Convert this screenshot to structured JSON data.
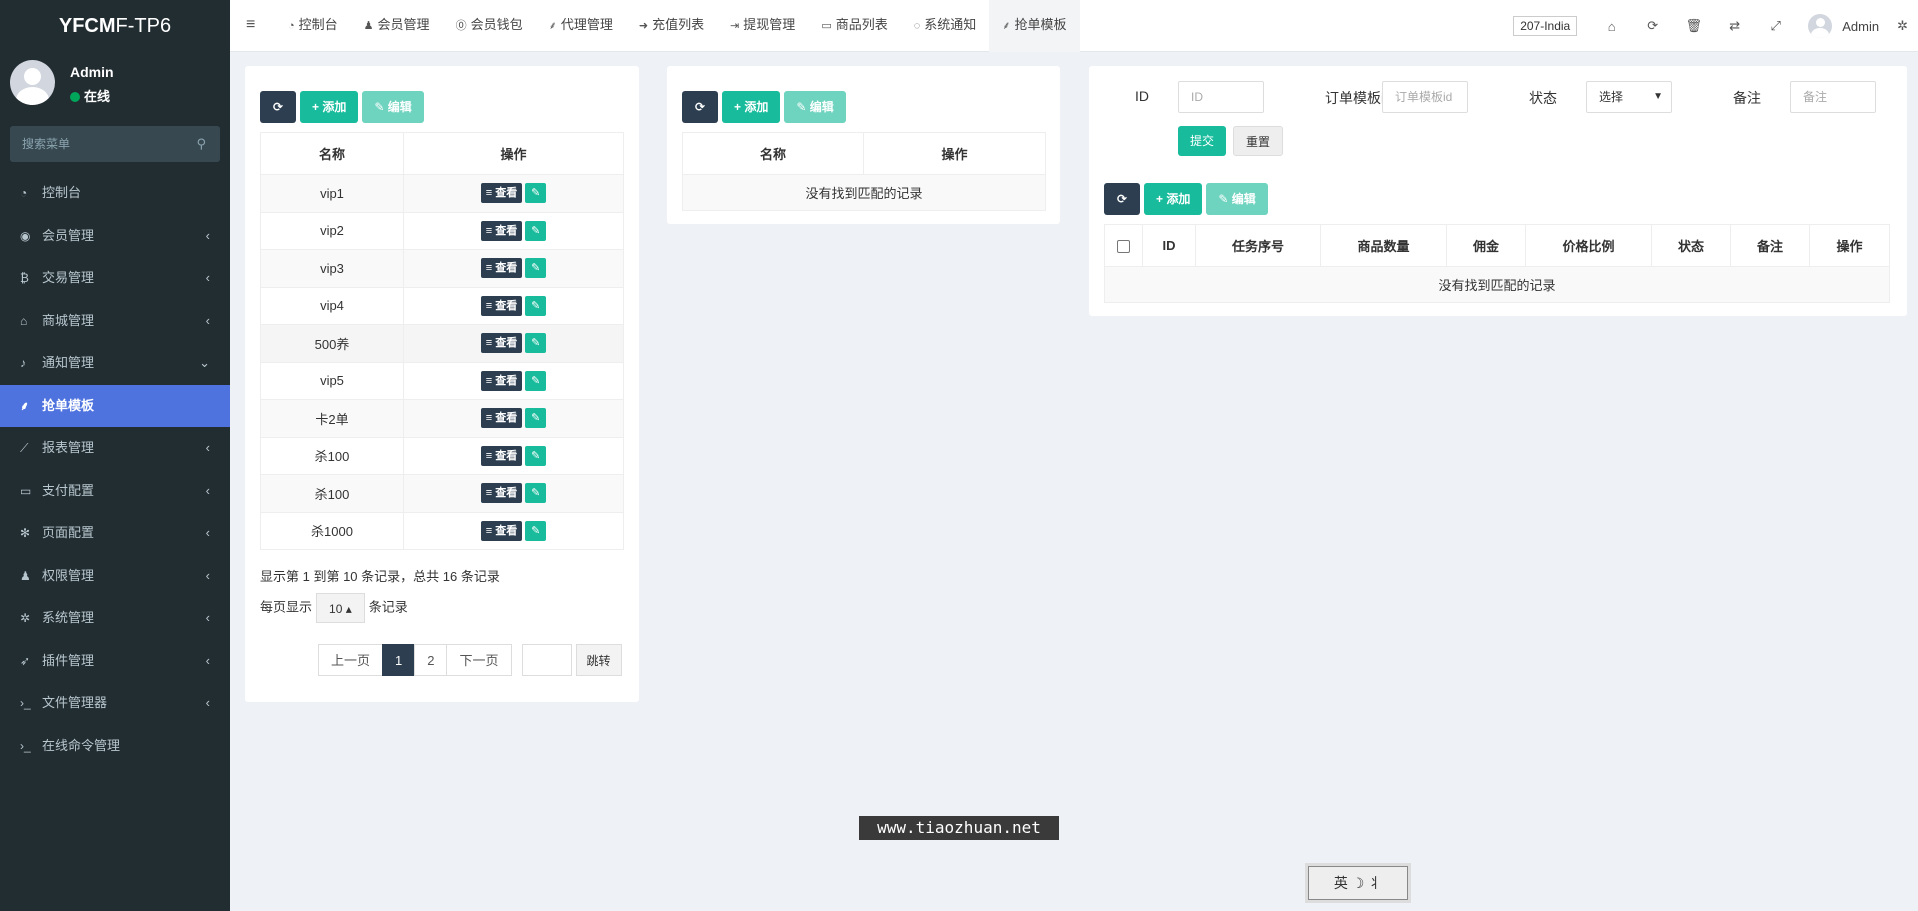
{
  "app": {
    "logo_bold": "YFCM",
    "logo_thin": "F-TP6"
  },
  "user": {
    "name": "Admin",
    "status": "在线"
  },
  "sidebar": {
    "search_placeholder": "搜索菜单",
    "items": [
      {
        "label": "控制台",
        "icon": "dashboard-icon",
        "glyph": "◔",
        "has_arrow": false,
        "active": false
      },
      {
        "label": "会员管理",
        "icon": "user-circle-icon",
        "glyph": "◉",
        "has_arrow": true,
        "arrow": "‹",
        "active": false
      },
      {
        "label": "交易管理",
        "icon": "bitcoin-icon",
        "glyph": "₿",
        "has_arrow": true,
        "arrow": "‹",
        "active": false
      },
      {
        "label": "商城管理",
        "icon": "home-icon",
        "glyph": "⌂",
        "has_arrow": true,
        "arrow": "‹",
        "active": false
      },
      {
        "label": "通知管理",
        "icon": "bell-icon",
        "glyph": "♪",
        "has_arrow": true,
        "arrow": "⌄",
        "active": false
      },
      {
        "label": "抢单模板",
        "icon": "sitemap-icon",
        "glyph": "⸙",
        "has_arrow": false,
        "active": true
      },
      {
        "label": "报表管理",
        "icon": "line-chart-icon",
        "glyph": "⟋",
        "has_arrow": true,
        "arrow": "‹",
        "active": false
      },
      {
        "label": "支付配置",
        "icon": "credit-card-icon",
        "glyph": "▭",
        "has_arrow": true,
        "arrow": "‹",
        "active": false
      },
      {
        "label": "页面配置",
        "icon": "cog-icon",
        "glyph": "✻",
        "has_arrow": true,
        "arrow": "‹",
        "active": false
      },
      {
        "label": "权限管理",
        "icon": "users-group-icon",
        "glyph": "♟",
        "has_arrow": true,
        "arrow": "‹",
        "active": false
      },
      {
        "label": "系统管理",
        "icon": "cogs-icon",
        "glyph": "✲",
        "has_arrow": true,
        "arrow": "‹",
        "active": false
      },
      {
        "label": "插件管理",
        "icon": "rocket-icon",
        "glyph": "➶",
        "has_arrow": true,
        "arrow": "‹",
        "active": false
      },
      {
        "label": "文件管理器",
        "icon": "terminal-icon",
        "glyph": "›_",
        "has_arrow": true,
        "arrow": "‹",
        "active": false
      },
      {
        "label": "在线命令管理",
        "icon": "terminal-icon",
        "glyph": "›_",
        "has_arrow": false,
        "active": false
      }
    ]
  },
  "topnav": {
    "tabs": [
      {
        "label": "控制台",
        "icon": "dashboard-icon",
        "glyph": "◔",
        "active": false
      },
      {
        "label": "会员管理",
        "icon": "user-icon",
        "glyph": "♟",
        "active": false
      },
      {
        "label": "会员钱包",
        "icon": "wallet-icon",
        "glyph": "⓪",
        "active": false
      },
      {
        "label": "代理管理",
        "icon": "sitemap-icon",
        "glyph": "⸙",
        "active": false
      },
      {
        "label": "充值列表",
        "icon": "sign-in-icon",
        "glyph": "➜",
        "active": false
      },
      {
        "label": "提现管理",
        "icon": "sign-out-icon",
        "glyph": "⇥",
        "active": false
      },
      {
        "label": "商品列表",
        "icon": "desktop-icon",
        "glyph": "▭",
        "active": false
      },
      {
        "label": "系统通知",
        "icon": "comments-icon",
        "glyph": "◌",
        "active": false
      },
      {
        "label": "抢单模板",
        "icon": "sitemap-icon",
        "glyph": "⸙",
        "active": true
      }
    ],
    "region": "207-India",
    "admin": "Admin"
  },
  "toolbar": {
    "refresh": "⟳",
    "add": "+ 添加",
    "edit": "✎ 编辑"
  },
  "left_table": {
    "headers": [
      "名称",
      "操作"
    ],
    "rows": [
      "vip1",
      "vip2",
      "vip3",
      "vip4",
      "500养",
      "vip5",
      "卡2单",
      "杀100",
      "杀100",
      "杀1000"
    ],
    "view_label": "≡ 查看",
    "edit_glyph": "✎",
    "info": "显示第 1 到第 10 条记录，总共 16 条记录",
    "per_page_prefix": "每页显示",
    "per_page_value": "10 ▴",
    "per_page_suffix": "条记录",
    "pager": {
      "prev": "上一页",
      "pages": [
        "1",
        "2"
      ],
      "next": "下一页",
      "jump": "跳转"
    }
  },
  "middle_table": {
    "headers": [
      "名称",
      "操作"
    ],
    "empty": "没有找到匹配的记录"
  },
  "search_form": {
    "id_label": "ID",
    "id_placeholder": "ID",
    "template_label": "订单模板id",
    "template_placeholder": "订单模板id",
    "status_label": "状态",
    "status_value": "选择",
    "remark_label": "备注",
    "remark_placeholder": "备注",
    "submit": "提交",
    "reset": "重置"
  },
  "right_table": {
    "headers": [
      "ID",
      "任务序号",
      "商品数量",
      "佣金",
      "价格比例",
      "状态",
      "备注",
      "操作"
    ],
    "empty": "没有找到匹配的记录"
  },
  "watermark": "www.tiaozhuan.net",
  "ime": "英 ☽ ⺦"
}
